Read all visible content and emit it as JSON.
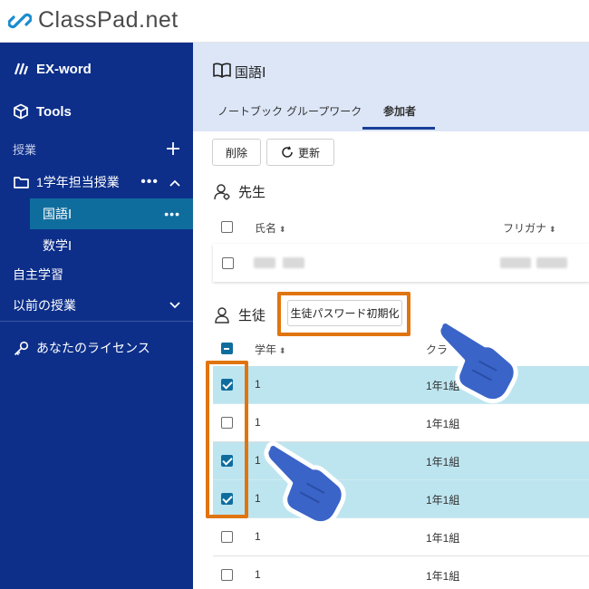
{
  "app": {
    "title": "ClassPad.net"
  },
  "sidebar": {
    "exword": "EX-word",
    "tools": "Tools",
    "classes_label": "授業",
    "group": "1学年担当授業",
    "subitems": [
      "国語Ⅰ",
      "数学Ⅰ"
    ],
    "self_study": "自主学習",
    "previous": "以前の授業",
    "license": "あなたのライセンス"
  },
  "course": {
    "title": "国語Ⅰ",
    "tabs": [
      "ノートブック",
      "グループワーク",
      "参加者"
    ],
    "active_tab": "参加者"
  },
  "toolbar": {
    "delete": "削除",
    "refresh": "更新"
  },
  "teachers": {
    "section": "先生",
    "col_name": "氏名",
    "col_furigana": "フリガナ"
  },
  "students": {
    "section": "生徒",
    "reset_password": "生徒パスワード初期化",
    "col_grade": "学年",
    "col_class": "クラ",
    "rows": [
      {
        "grade": "1",
        "class": "1年1組",
        "checked": true
      },
      {
        "grade": "1",
        "class": "1年1組",
        "checked": false
      },
      {
        "grade": "1",
        "class": "1年1組",
        "checked": true
      },
      {
        "grade": "1",
        "class": "1年1組",
        "checked": true
      },
      {
        "grade": "1",
        "class": "1年1組",
        "checked": false
      },
      {
        "grade": "1",
        "class": "1年1組",
        "checked": false
      }
    ]
  },
  "colors": {
    "sidebar": "#0d2f8a",
    "sidebar_active": "#0f6d9e",
    "header": "#dce6f7",
    "row_selected": "#bde5ef",
    "highlight": "#e0740f",
    "hand": "#3a64c8"
  }
}
